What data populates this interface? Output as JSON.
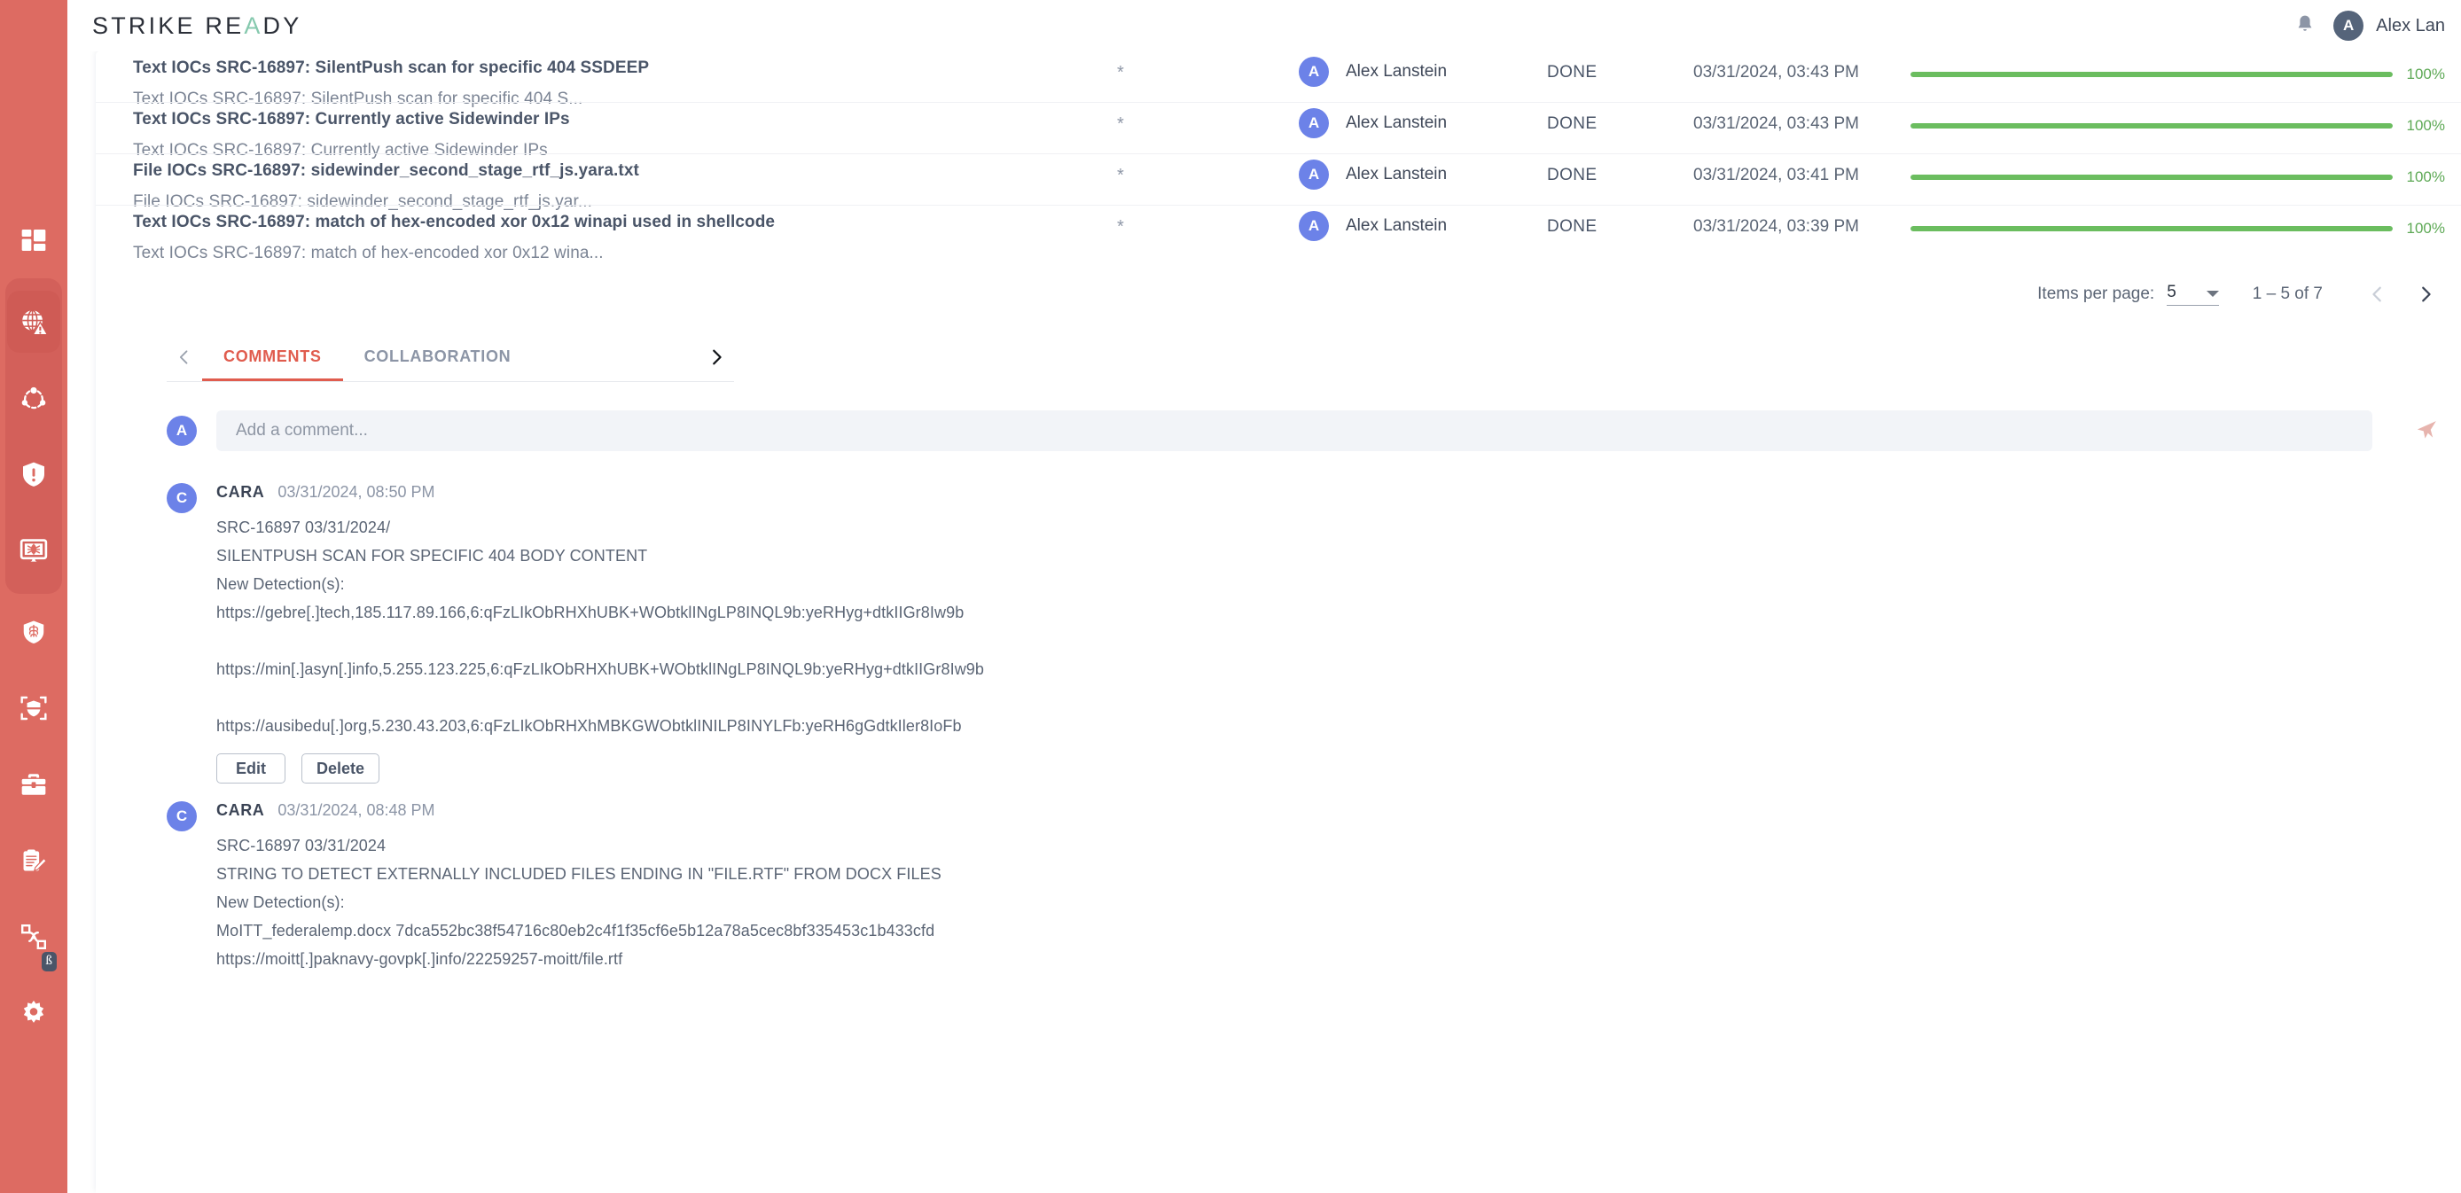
{
  "brand": {
    "text_left": "STRIKE RE",
    "text_accent": "A",
    "text_right": "DY",
    "full": "STRIKE READY",
    "accent_color": "#86c9ae"
  },
  "topbar": {
    "bell_icon": "bell-icon",
    "user_initial": "A",
    "user_name": "Alex Lan"
  },
  "sidebar": {
    "background": "#dd6b62",
    "items": [
      {
        "name": "dashboard",
        "icon": "dashboard-grid-icon",
        "active": false
      },
      {
        "name": "threat-intel",
        "icon": "globe-alert-icon",
        "active": true
      },
      {
        "name": "graph",
        "icon": "network-nodes-icon",
        "active": false
      },
      {
        "name": "alerts",
        "icon": "shield-exclamation-icon",
        "active": false
      },
      {
        "name": "malware",
        "icon": "monitor-bug-icon",
        "active": false
      },
      {
        "name": "ai-defense",
        "icon": "shield-brain-icon",
        "active": false
      },
      {
        "name": "detection-scan",
        "icon": "shield-scan-icon",
        "active": false
      },
      {
        "name": "cases",
        "icon": "briefcase-icon",
        "active": false
      },
      {
        "name": "reports",
        "icon": "clipboard-pencil-icon",
        "active": false
      },
      {
        "name": "workflows",
        "icon": "workflow-nodes-icon",
        "active": false,
        "badge": "ß"
      },
      {
        "name": "settings",
        "icon": "gear-icon",
        "active": false
      }
    ]
  },
  "table": {
    "rows": [
      {
        "title": "Text IOCs SRC-16897: SilentPush scan for specific 404 SSDEEP",
        "subtitle": "Text IOCs SRC-16897: SilentPush scan for specific 404 S...",
        "star": "*",
        "user_initial": "A",
        "user": "Alex Lanstein",
        "status": "DONE",
        "date": "03/31/2024, 03:43 PM",
        "progress": 100,
        "progress_label": "100%"
      },
      {
        "title": "Text IOCs SRC-16897: Currently active Sidewinder IPs",
        "subtitle": "Text IOCs SRC-16897: Currently active Sidewinder IPs",
        "star": "*",
        "user_initial": "A",
        "user": "Alex Lanstein",
        "status": "DONE",
        "date": "03/31/2024, 03:43 PM",
        "progress": 100,
        "progress_label": "100%"
      },
      {
        "title": "File IOCs SRC-16897: sidewinder_second_stage_rtf_js.yara.txt",
        "subtitle": "File IOCs SRC-16897: sidewinder_second_stage_rtf_js.yar...",
        "star": "*",
        "user_initial": "A",
        "user": "Alex Lanstein",
        "status": "DONE",
        "date": "03/31/2024, 03:41 PM",
        "progress": 100,
        "progress_label": "100%"
      },
      {
        "title": "Text IOCs SRC-16897: match of hex-encoded xor 0x12 winapi used in shellcode",
        "subtitle": "Text IOCs SRC-16897: match of hex-encoded xor 0x12 wina...",
        "star": "*",
        "user_initial": "A",
        "user": "Alex Lanstein",
        "status": "DONE",
        "date": "03/31/2024, 03:39 PM",
        "progress": 100,
        "progress_label": "100%"
      }
    ]
  },
  "paginator": {
    "items_per_page_label": "Items per page:",
    "items_per_page_value": "5",
    "range": "1 – 5 of 7",
    "prev_icon": "chevron-left-icon",
    "next_icon": "chevron-right-icon"
  },
  "tabs": {
    "prev_icon": "chevron-left-icon",
    "next_icon": "chevron-right-icon",
    "items": [
      {
        "label": "COMMENTS",
        "active": true
      },
      {
        "label": "COLLABORATION",
        "active": false
      }
    ],
    "active_color": "#e05c4e"
  },
  "comment_input": {
    "avatar_initial": "A",
    "placeholder": "Add a comment...",
    "value": "",
    "send_icon": "send-paper-plane-icon"
  },
  "comments": [
    {
      "avatar_initial": "C",
      "author": "CARA",
      "time": "03/31/2024, 08:50 PM",
      "lines": [
        "SRC-16897 03/31/2024/",
        "SILENTPUSH SCAN FOR SPECIFIC 404 BODY CONTENT",
        "New Detection(s):",
        "https://gebre[.]tech,185.117.89.166,6:qFzLIkObRHXhUBK+WObtklINgLP8INQL9b:yeRHyg+dtkIIGr8Iw9b",
        "",
        "https://min[.]asyn[.]info,5.255.123.225,6:qFzLIkObRHXhUBK+WObtklINgLP8INQL9b:yeRHyg+dtkIIGr8Iw9b",
        "",
        "https://ausibedu[.]org,5.230.43.203,6:qFzLIkObRHXhMBKGWObtklINILP8INYLFb:yeRH6gGdtkIler8IoFb"
      ],
      "actions": [
        "Edit",
        "Delete"
      ]
    },
    {
      "avatar_initial": "C",
      "author": "CARA",
      "time": "03/31/2024, 08:48 PM",
      "lines": [
        "SRC-16897 03/31/2024",
        "STRING TO DETECT EXTERNALLY INCLUDED FILES ENDING IN \"FILE.RTF\" FROM DOCX FILES",
        "New Detection(s):",
        "MoITT_federalemp.docx 7dca552bc38f54716c80eb2c4f1f35cf6e5b12a78a5cec8bf335453c1b433cfd",
        "https://moitt[.]paknavy-govpk[.]info/22259257-moitt/file.rtf"
      ],
      "actions": []
    }
  ],
  "colors": {
    "sidebar": "#dd6b62",
    "accent": "#e05c4e",
    "avatar_blue": "#6c82e8",
    "avatar_dark": "#55647a",
    "progress_green": "#6bbd5f"
  }
}
